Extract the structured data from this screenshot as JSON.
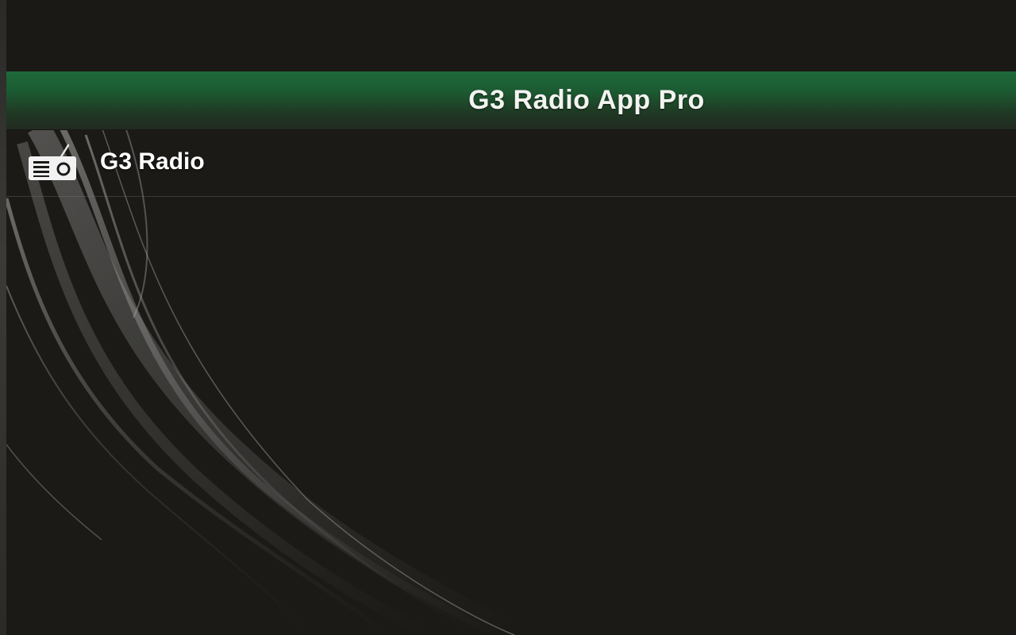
{
  "app": {
    "title": "G3 Radio App Pro"
  },
  "list": {
    "items": [
      {
        "label": "G3 Radio",
        "icon": "radio-icon"
      }
    ]
  },
  "colors": {
    "title_bar_green": "#1e6a3a",
    "background": "#1b1a17",
    "text": "#ffffff"
  }
}
